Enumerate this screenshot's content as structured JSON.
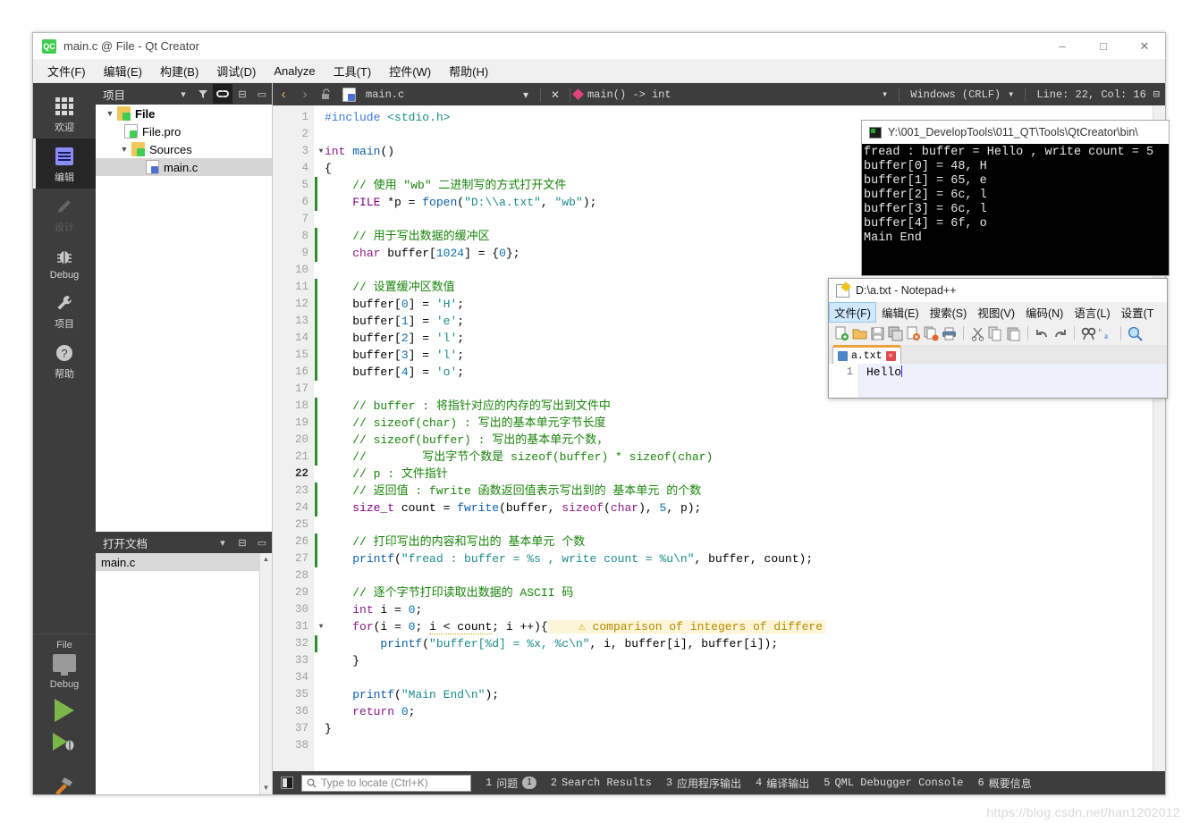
{
  "window": {
    "title": "main.c @ File - Qt Creator",
    "app_icon": "qt-logo-icon",
    "minimize": "–",
    "maximize": "□",
    "close": "✕"
  },
  "menubar": {
    "items": [
      {
        "label": "文件(F)",
        "name": "menu-file"
      },
      {
        "label": "编辑(E)",
        "name": "menu-edit"
      },
      {
        "label": "构建(B)",
        "name": "menu-build"
      },
      {
        "label": "调试(D)",
        "name": "menu-debug"
      },
      {
        "label": "Analyze",
        "name": "menu-analyze"
      },
      {
        "label": "工具(T)",
        "name": "menu-tools"
      },
      {
        "label": "控件(W)",
        "name": "menu-window"
      },
      {
        "label": "帮助(H)",
        "name": "menu-help"
      }
    ]
  },
  "modebar": {
    "items": [
      {
        "label": "欢迎",
        "icon": "grid-icon",
        "state": "normal"
      },
      {
        "label": "编辑",
        "icon": "document-icon",
        "state": "active"
      },
      {
        "label": "设计",
        "icon": "pencil-icon",
        "state": "disabled"
      },
      {
        "label": "Debug",
        "icon": "bug-icon",
        "state": "normal"
      },
      {
        "label": "项目",
        "icon": "wrench-icon",
        "state": "normal"
      },
      {
        "label": "帮助",
        "icon": "question-icon",
        "state": "normal"
      }
    ],
    "kit_label": "File",
    "kit_mode": "Debug"
  },
  "project_dock": {
    "title": "项目",
    "tree": [
      {
        "label": "File",
        "depth": 0,
        "twisty": "▼",
        "icon": "qt-project-folder-icon",
        "bold": true,
        "selected": false
      },
      {
        "label": "File.pro",
        "depth": 1,
        "twisty": "",
        "icon": "qt-pro-file-icon",
        "bold": false,
        "selected": false
      },
      {
        "label": "Sources",
        "depth": 1,
        "twisty": "▼",
        "icon": "sources-folder-icon",
        "bold": false,
        "selected": false
      },
      {
        "label": "main.c",
        "depth": 2,
        "twisty": "",
        "icon": "c-file-icon",
        "bold": false,
        "selected": true
      }
    ]
  },
  "opendocs_dock": {
    "title": "打开文档",
    "items": [
      {
        "label": "main.c",
        "selected": true
      }
    ]
  },
  "editor_toolbar": {
    "back": "‹",
    "forward": "›",
    "lock": "unlocked-padlock",
    "file_name": "main.c",
    "close_file": "✕",
    "symbol": "main() -> int",
    "line_ending": "Windows (CRLF)",
    "cursor_position": "Line: 22, Col: 16",
    "split": "split-icon"
  },
  "editor": {
    "current_line": 22,
    "total_lines": 38,
    "lines": [
      {
        "n": 1,
        "fold": "",
        "change": false,
        "html": "<span class='pp'>#include</span> <span class='st'>&lt;stdio.h&gt;</span>"
      },
      {
        "n": 2,
        "fold": "",
        "change": false,
        "html": ""
      },
      {
        "n": 3,
        "fold": "▼",
        "change": false,
        "html": "<span class='k'>int</span> <span class='fn'>main</span>()"
      },
      {
        "n": 4,
        "fold": "",
        "change": false,
        "html": "{"
      },
      {
        "n": 5,
        "fold": "",
        "change": true,
        "html": "    <span class='cm'>// 使用 \"wb\" 二进制写的方式打开文件</span>"
      },
      {
        "n": 6,
        "fold": "",
        "change": true,
        "html": "    <span class='ty'>FILE</span> *p = <span class='fn'>fopen</span>(<span class='st'>\"D:\\\\a.txt\"</span>, <span class='st'>\"wb\"</span>);"
      },
      {
        "n": 7,
        "fold": "",
        "change": false,
        "html": ""
      },
      {
        "n": 8,
        "fold": "",
        "change": true,
        "html": "    <span class='cm'>// 用于写出数据的缓冲区</span>"
      },
      {
        "n": 9,
        "fold": "",
        "change": true,
        "html": "    <span class='k'>char</span> buffer[<span class='nm'>1024</span>] = {<span class='nm'>0</span>};"
      },
      {
        "n": 10,
        "fold": "",
        "change": false,
        "html": ""
      },
      {
        "n": 11,
        "fold": "",
        "change": true,
        "html": "    <span class='cm'>// 设置缓冲区数值</span>"
      },
      {
        "n": 12,
        "fold": "",
        "change": true,
        "html": "    buffer[<span class='nm'>0</span>] = <span class='st'>'H'</span>;"
      },
      {
        "n": 13,
        "fold": "",
        "change": true,
        "html": "    buffer[<span class='nm'>1</span>] = <span class='st'>'e'</span>;"
      },
      {
        "n": 14,
        "fold": "",
        "change": true,
        "html": "    buffer[<span class='nm'>2</span>] = <span class='st'>'l'</span>;"
      },
      {
        "n": 15,
        "fold": "",
        "change": true,
        "html": "    buffer[<span class='nm'>3</span>] = <span class='st'>'l'</span>;"
      },
      {
        "n": 16,
        "fold": "",
        "change": true,
        "html": "    buffer[<span class='nm'>4</span>] = <span class='st'>'o'</span>;"
      },
      {
        "n": 17,
        "fold": "",
        "change": false,
        "html": ""
      },
      {
        "n": 18,
        "fold": "",
        "change": true,
        "html": "    <span class='cm'>// buffer : 将指针对应的内存的写出到文件中</span>"
      },
      {
        "n": 19,
        "fold": "",
        "change": true,
        "html": "    <span class='cm'>// sizeof(char) : 写出的基本单元字节长度</span>"
      },
      {
        "n": 20,
        "fold": "",
        "change": true,
        "html": "    <span class='cm'>// sizeof(buffer) : 写出的基本单元个数，</span>"
      },
      {
        "n": 21,
        "fold": "",
        "change": true,
        "html": "    <span class='cm'>//        写出字节个数是 sizeof(buffer) * sizeof(char)</span>"
      },
      {
        "n": 22,
        "fold": "",
        "change": false,
        "html": "    <span class='cm'>// p : 文件指针</span>"
      },
      {
        "n": 23,
        "fold": "",
        "change": true,
        "html": "    <span class='cm'>// 返回值 : fwrite 函数返回值表示写出到的 基本单元 的个数</span>"
      },
      {
        "n": 24,
        "fold": "",
        "change": true,
        "html": "    <span class='ty'>size_t</span> count = <span class='fn'>fwrite</span>(buffer, <span class='k'>sizeof</span>(<span class='k'>char</span>), <span class='nm'>5</span>, p);"
      },
      {
        "n": 25,
        "fold": "",
        "change": false,
        "html": ""
      },
      {
        "n": 26,
        "fold": "",
        "change": true,
        "html": "    <span class='cm'>// 打印写出的内容和写出的 基本单元 个数</span>"
      },
      {
        "n": 27,
        "fold": "",
        "change": true,
        "html": "    <span class='fn'>printf</span>(<span class='st'>\"fread : buffer = %s , write count = %u\\n\"</span>, buffer, count);"
      },
      {
        "n": 28,
        "fold": "",
        "change": false,
        "html": ""
      },
      {
        "n": 29,
        "fold": "",
        "change": false,
        "html": "    <span class='cm'>// 逐个字节打印读取出数据的 ASCII 码</span>"
      },
      {
        "n": 30,
        "fold": "",
        "change": false,
        "html": "    <span class='k'>int</span> i = <span class='nm'>0</span>;"
      },
      {
        "n": 31,
        "fold": "▼",
        "change": false,
        "html": "    <span class='k'>for</span>(i = <span class='nm'>0</span>; <span class='underline-warn'>i &lt; count</span>; i ++){<span class='warn-inline'>    <span class='warn-tri'>⚠</span> comparison of integers of differe</span>"
      },
      {
        "n": 32,
        "fold": "",
        "change": true,
        "html": "        <span class='fn'>printf</span>(<span class='st'>\"buffer[%d] = %x, %c\\n\"</span>, i, buffer[i], buffer[i]);"
      },
      {
        "n": 33,
        "fold": "",
        "change": false,
        "html": "    }"
      },
      {
        "n": 34,
        "fold": "",
        "change": false,
        "html": ""
      },
      {
        "n": 35,
        "fold": "",
        "change": false,
        "html": "    <span class='fn'>printf</span>(<span class='st'>\"Main End\\n\"</span>);"
      },
      {
        "n": 36,
        "fold": "",
        "change": false,
        "html": "    <span class='k'>return</span> <span class='nm'>0</span>;"
      },
      {
        "n": 37,
        "fold": "",
        "change": false,
        "html": "}"
      },
      {
        "n": 38,
        "fold": "",
        "change": false,
        "html": ""
      }
    ]
  },
  "statusbar": {
    "locator_placeholder": "Type to locate (Ctrl+K)",
    "panes": [
      {
        "num": "1",
        "label": "问题",
        "badge": "1"
      },
      {
        "num": "2",
        "label": "Search Results",
        "badge": ""
      },
      {
        "num": "3",
        "label": "应用程序输出",
        "badge": ""
      },
      {
        "num": "4",
        "label": "编译输出",
        "badge": ""
      },
      {
        "num": "5",
        "label": "QML Debugger Console",
        "badge": ""
      },
      {
        "num": "6",
        "label": "概要信息",
        "badge": ""
      }
    ]
  },
  "console": {
    "title": "Y:\\001_DevelopTools\\011_QT\\Tools\\QtCreator\\bin\\",
    "lines": [
      "fread : buffer = Hello , write count = 5",
      "buffer[0] = 48, H",
      "buffer[1] = 65, e",
      "buffer[2] = 6c, l",
      "buffer[3] = 6c, l",
      "buffer[4] = 6f, o",
      "Main End"
    ]
  },
  "notepad": {
    "title": "D:\\a.txt - Notepad++",
    "menu": [
      "文件(F)",
      "编辑(E)",
      "搜索(S)",
      "视图(V)",
      "编码(N)",
      "语言(L)",
      "设置(T"
    ],
    "toolbar_icons": [
      "new-file-icon",
      "open-folder-icon",
      "save-icon",
      "save-all-icon",
      "close-file-icon",
      "close-all-icon",
      "print-icon",
      "cut-icon",
      "copy-icon",
      "paste-icon",
      "undo-icon",
      "redo-icon",
      "find-icon",
      "replace-icon",
      "zoom-in-icon"
    ],
    "tab": {
      "label": "a.txt",
      "close": "✕"
    },
    "document": {
      "line_number": "1",
      "text": "Hello"
    }
  },
  "watermark": "https://blog.csdn.net/han1202012",
  "colors": {
    "accent_green": "#41cd52",
    "dark_chrome": "#3d3d3d",
    "comment_green": "#18850a",
    "string_teal": "#1a8b8b",
    "warning_amber": "#e8a000"
  }
}
